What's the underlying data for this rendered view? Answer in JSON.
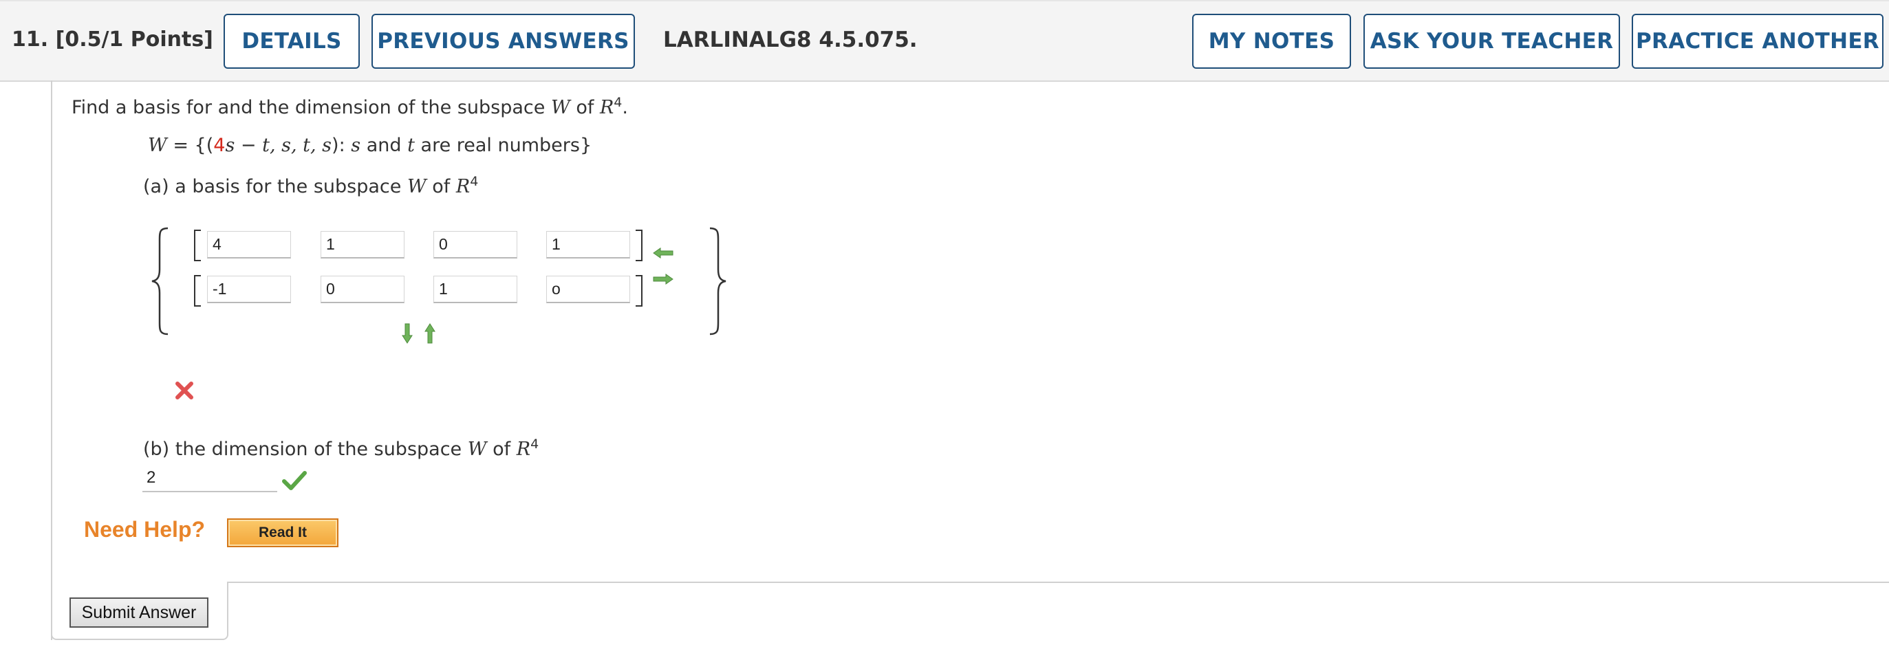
{
  "header": {
    "question_number": "11.",
    "points": "[0.5/1 Points]",
    "details_label": "DETAILS",
    "previous_answers_label": "PREVIOUS ANSWERS",
    "reference_code": "LARLINALG8 4.5.075.",
    "my_notes_label": "MY NOTES",
    "ask_teacher_label": "ASK YOUR TEACHER",
    "practice_another_label": "PRACTICE ANOTHER"
  },
  "question": {
    "prompt_prefix": "Find a basis for and the dimension of the subspace ",
    "prompt_var": "W",
    "prompt_mid": " of ",
    "prompt_space": "R",
    "prompt_exp": "4",
    "prompt_end": ".",
    "set_lhs": "W",
    "set_eq": " = {(",
    "set_coef": "4",
    "set_rest_a": "s",
    "set_rest_b": " − ",
    "set_rest_c": "t, s, t, s",
    "set_rest_d": "): ",
    "set_s": "s",
    "set_and": " and ",
    "set_t": "t",
    "set_end": " are real numbers}",
    "part_a_prefix": "(a) a basis for the subspace ",
    "part_a_var": "W",
    "part_a_mid": " of ",
    "part_a_space": "R",
    "part_a_exp": "4",
    "part_b_prefix": "(b) the dimension of the subspace ",
    "part_b_var": "W",
    "part_b_mid": " of ",
    "part_b_space": "R",
    "part_b_exp": "4"
  },
  "basis": {
    "row1": [
      "4",
      "1",
      "0",
      "1"
    ],
    "row2": [
      "-1",
      "0",
      "1",
      "o"
    ]
  },
  "dimension_answer": "2",
  "status": {
    "part_a": "incorrect",
    "part_b": "correct"
  },
  "help": {
    "need_help_label": "Need Help?",
    "read_it_label": "Read It"
  },
  "submit_label": "Submit Answer",
  "colors": {
    "link_blue": "#1f5b8e",
    "incorrect_red": "#e05252",
    "correct_green": "#5aa645",
    "arrow_green": "#6fb35a",
    "need_help_orange": "#e8842a"
  }
}
